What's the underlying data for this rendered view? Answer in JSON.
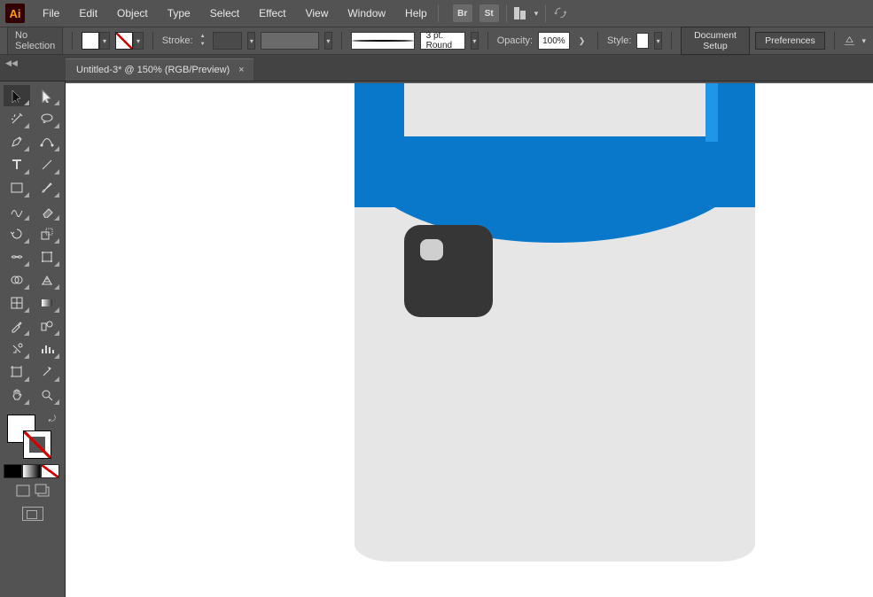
{
  "menubar": {
    "items": [
      "File",
      "Edit",
      "Object",
      "Type",
      "Select",
      "Effect",
      "View",
      "Window",
      "Help"
    ],
    "br": "Br",
    "st": "St"
  },
  "controlbar": {
    "selection": "No Selection",
    "stroke_label": "Stroke:",
    "brush_def": "3 pt. Round",
    "opacity_label": "Opacity:",
    "opacity_value": "100%",
    "style_label": "Style:",
    "doc_setup": "Document Setup",
    "preferences": "Preferences"
  },
  "tab": {
    "title": "Untitled-3* @ 150% (RGB/Preview)"
  },
  "tools": {
    "names": [
      "selection-tool",
      "direct-selection-tool",
      "magic-wand-tool",
      "lasso-tool",
      "pen-tool",
      "curvature-tool",
      "type-tool",
      "line-segment-tool",
      "rectangle-tool",
      "paintbrush-tool",
      "shaper-tool",
      "eraser-tool",
      "rotate-tool",
      "scale-tool",
      "width-tool",
      "free-transform-tool",
      "shape-builder-tool",
      "perspective-grid-tool",
      "mesh-tool",
      "gradient-tool",
      "eyedropper-tool",
      "blend-tool",
      "symbol-sprayer-tool",
      "column-graph-tool",
      "artboard-tool",
      "slice-tool",
      "hand-tool",
      "zoom-tool"
    ]
  }
}
